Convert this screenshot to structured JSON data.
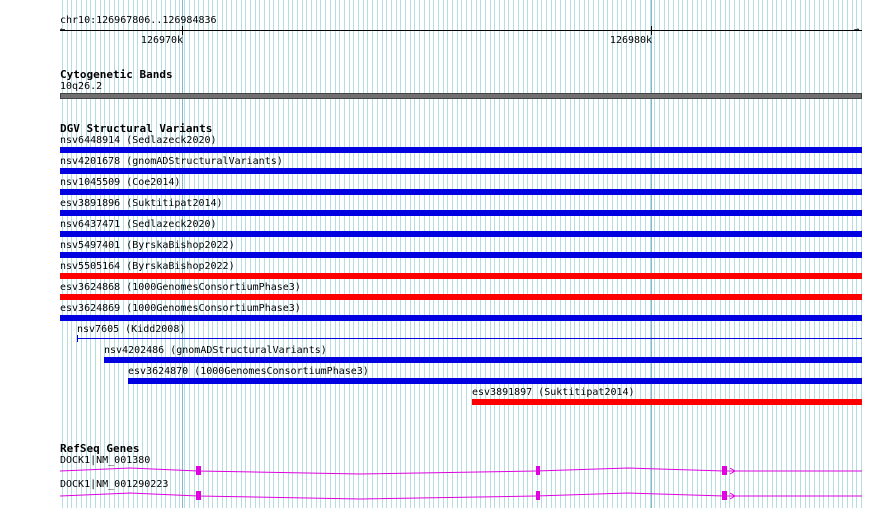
{
  "ruler": {
    "range": "chr10:126967806..126984836",
    "ticks": [
      "126970k",
      "126980k"
    ]
  },
  "cytoband": {
    "title": "Cytogenetic Bands",
    "label": "10q26.2"
  },
  "dgv": {
    "title": "DGV Structural Variants",
    "items": [
      {
        "label": "nsv6448914 (Sedlazeck2020)",
        "color": "#0000e0"
      },
      {
        "label": "nsv4201678 (gnomADStructuralVariants)",
        "color": "#0000e0"
      },
      {
        "label": "nsv1045509 (Coe2014)",
        "color": "#0000e0"
      },
      {
        "label": "esv3891896 (Suktitipat2014)",
        "color": "#0000e0"
      },
      {
        "label": "nsv6437471 (Sedlazeck2020)",
        "color": "#0000e0"
      },
      {
        "label": "nsv5497401 (ByrskaBishop2022)",
        "color": "#0000e0"
      },
      {
        "label": "nsv5505164 (ByrskaBishop2022)",
        "color": "#ff0000"
      },
      {
        "label": "esv3624868 (1000GenomesConsortiumPhase3)",
        "color": "#ff0000"
      },
      {
        "label": "esv3624869 (1000GenomesConsortiumPhase3)",
        "color": "#0000e0"
      },
      {
        "label": "nsv7605 (Kidd2008)",
        "color": "#0000e0"
      },
      {
        "label": "nsv4202486 (gnomADStructuralVariants)",
        "color": "#0000e0"
      },
      {
        "label": "esv3624870 (1000GenomesConsortiumPhase3)",
        "color": "#0000e0"
      },
      {
        "label": "esv3891897 (Suktitipat2014)",
        "color": "#ff0000"
      }
    ]
  },
  "refseq": {
    "title": "RefSeq Genes",
    "items": [
      {
        "label": "DOCK1|NM_001380"
      },
      {
        "label": "DOCK1|NM_001290223"
      }
    ],
    "colors": {
      "exon": "#e000e0",
      "intron": "#e000e0"
    }
  }
}
